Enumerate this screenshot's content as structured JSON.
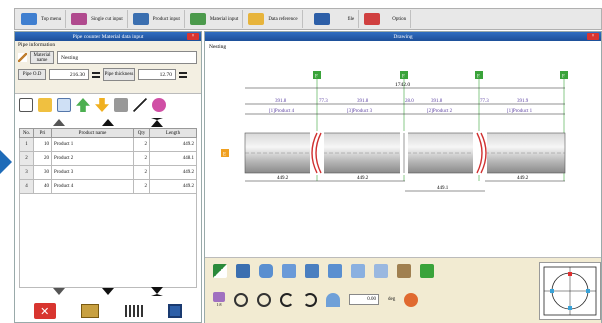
{
  "colors": {
    "accent_blue": "#1e6bb8",
    "title_blue": "#2f6ec2",
    "close_red": "#d8352f",
    "marker_green": "#3aa33a",
    "marker_orange": "#f0a020",
    "label_purple": "#5a3fa0"
  },
  "toolbar": {
    "items": [
      {
        "label": "Top menu",
        "icon": "top-menu-icon"
      },
      {
        "label": "Single cut input",
        "icon": "single-cut-icon"
      },
      {
        "label": "Product input",
        "icon": "product-input-icon"
      },
      {
        "label": "Material input",
        "icon": "material-input-icon"
      },
      {
        "label": "Data reference",
        "icon": "folder-icon"
      },
      {
        "label": "file",
        "icon": "save-icon"
      },
      {
        "label": "Option",
        "icon": "option-icon"
      }
    ]
  },
  "left_panel": {
    "title": "Pipe counter Material data input",
    "close": "×",
    "pipe_info_label": "Pipe information",
    "material_name_label": "Material name",
    "material_name_value": "Nesting",
    "pipe_od_label": "Pipe O.D",
    "pipe_od_value": "216.30",
    "thickness_label": "Pipe thickness",
    "thickness_value": "12.70",
    "table": {
      "headers": [
        "No.",
        "Pri",
        "Product name",
        "Qty",
        "Length"
      ],
      "rows": [
        {
          "no": "1",
          "pri": "10",
          "name": "Product 1",
          "qty": "2",
          "length": "449.2"
        },
        {
          "no": "2",
          "pri": "20",
          "name": "Product 2",
          "qty": "2",
          "length": "448.1"
        },
        {
          "no": "3",
          "pri": "30",
          "name": "Product 3",
          "qty": "2",
          "length": "449.2"
        },
        {
          "no": "4",
          "pri": "40",
          "name": "Product 4",
          "qty": "2",
          "length": "449.2"
        }
      ]
    }
  },
  "drawing": {
    "title": "Drawing",
    "close": "×",
    "tab_label": "Nesting",
    "total_length": "1742.0",
    "top_dims": [
      "391.8",
      "77.3",
      "391.8",
      "28.0",
      "391.8",
      "77.3",
      "391.9"
    ],
    "product_labels": [
      "[1]Product 4",
      "[3]Product 3",
      "[2]Product 2",
      "[1]Product 1"
    ],
    "bottom_dims": [
      "449.2",
      "449.2",
      "449.1",
      "449.2"
    ],
    "marker_letter": "F",
    "start_marker": "E",
    "angle_value": "0.00",
    "angle_unit": "deg",
    "zoom_label": "1:8"
  }
}
